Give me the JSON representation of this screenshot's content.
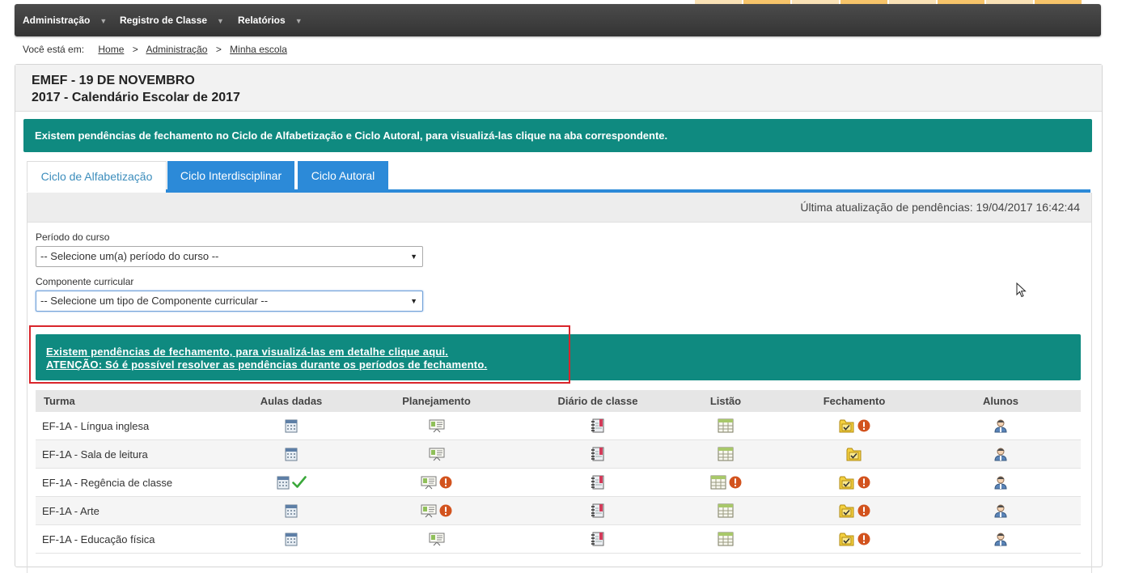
{
  "nav": {
    "items": [
      {
        "label": "Administração"
      },
      {
        "label": "Registro de Classe"
      },
      {
        "label": "Relatórios"
      }
    ]
  },
  "breadcrumb": {
    "prefix": "Você está em:",
    "links": [
      "Home",
      "Administração",
      "Minha escola"
    ],
    "separator": ">"
  },
  "header": {
    "school": "EMEF - 19 DE NOVEMBRO",
    "calendar": "2017 - Calendário Escolar de 2017"
  },
  "top_alert": "Existem pendências de fechamento no Ciclo de Alfabetização e Ciclo Autoral, para visualizá-las clique na aba correspondente.",
  "tabs": [
    {
      "label": "Ciclo de Alfabetização",
      "active": true
    },
    {
      "label": "Ciclo Interdisciplinar",
      "active": false
    },
    {
      "label": "Ciclo Autoral",
      "active": false
    }
  ],
  "last_update": "Última atualização de pendências: 19/04/2017 16:42:44",
  "filters": {
    "periodo_label": "Período do curso",
    "periodo_value": "-- Selecione um(a) período do curso --",
    "componente_label": "Componente curricular",
    "componente_value": "-- Selecione um tipo de Componente curricular --"
  },
  "pending_alert": {
    "line1": "Existem pendências de fechamento, para visualizá-las em detalhe clique aqui.",
    "line2": "ATENÇÃO: Só é possível resolver as pendências durante os períodos de fechamento."
  },
  "table": {
    "headers": [
      "Turma",
      "Aulas dadas",
      "Planejamento",
      "Diário de classe",
      "Listão",
      "Fechamento",
      "Alunos"
    ],
    "rows": [
      {
        "turma": "EF-1A - Língua inglesa",
        "aulas_ok": false,
        "plan_alert": false,
        "listao_alert": false,
        "fech_alert": true
      },
      {
        "turma": "EF-1A - Sala de leitura",
        "aulas_ok": false,
        "plan_alert": false,
        "listao_alert": false,
        "fech_alert": false
      },
      {
        "turma": "EF-1A - Regência de classe",
        "aulas_ok": true,
        "plan_alert": true,
        "listao_alert": true,
        "fech_alert": true
      },
      {
        "turma": "EF-1A - Arte",
        "aulas_ok": false,
        "plan_alert": true,
        "listao_alert": false,
        "fech_alert": true
      },
      {
        "turma": "EF-1A - Educação física",
        "aulas_ok": false,
        "plan_alert": false,
        "listao_alert": false,
        "fech_alert": true
      }
    ]
  },
  "icons": {
    "aulas": "calendar-icon",
    "planejamento": "presentation-board-icon",
    "diario": "notebook-icon",
    "listao": "spreadsheet-icon",
    "fechamento": "folder-check-icon",
    "alunos": "student-icon",
    "alert": "exclamation-icon",
    "check": "checkmark-icon"
  },
  "colors": {
    "navbar": "#3d3d3d",
    "alert_teal": "#0f8a80",
    "tab_blue": "#2c8ad8",
    "highlight_red": "#d9252b",
    "alert_orange": "#d2531e",
    "check_green": "#3aa83a"
  }
}
